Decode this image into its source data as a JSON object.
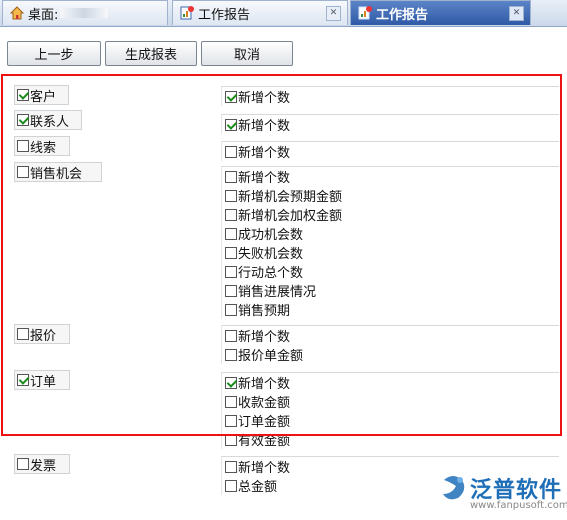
{
  "tabs": [
    {
      "label": "桌面:",
      "icon": "home-icon"
    },
    {
      "label": "工作报告",
      "icon": "report-icon"
    },
    {
      "label": "工作报告",
      "icon": "report-icon"
    }
  ],
  "toolbar": {
    "prev_label": "上一步",
    "generate_label": "生成报表",
    "cancel_label": "取消"
  },
  "groups": [
    {
      "label": "客户",
      "checked": true,
      "options": [
        {
          "label": "新增个数",
          "checked": true
        }
      ]
    },
    {
      "label": "联系人",
      "checked": true,
      "options": [
        {
          "label": "新增个数",
          "checked": true
        }
      ]
    },
    {
      "label": "线索",
      "checked": false,
      "options": [
        {
          "label": "新增个数",
          "checked": false
        }
      ]
    },
    {
      "label": "销售机会",
      "checked": false,
      "options": [
        {
          "label": "新增个数",
          "checked": false
        },
        {
          "label": "新增机会预期金额",
          "checked": false
        },
        {
          "label": "新增机会加权金额",
          "checked": false
        },
        {
          "label": "成功机会数",
          "checked": false
        },
        {
          "label": "失败机会数",
          "checked": false
        },
        {
          "label": "行动总个数",
          "checked": false
        },
        {
          "label": "销售进展情况",
          "checked": false
        },
        {
          "label": "销售预期",
          "checked": false
        }
      ]
    },
    {
      "label": "报价",
      "checked": false,
      "options": [
        {
          "label": "新增个数",
          "checked": false
        },
        {
          "label": "报价单金额",
          "checked": false
        }
      ]
    },
    {
      "label": "订单",
      "checked": true,
      "options": [
        {
          "label": "新增个数",
          "checked": true
        },
        {
          "label": "收款金额",
          "checked": false
        },
        {
          "label": "订单金额",
          "checked": false
        },
        {
          "label": "有效金额",
          "checked": false
        }
      ]
    },
    {
      "label": "发票",
      "checked": false,
      "options": [
        {
          "label": "新增个数",
          "checked": false
        },
        {
          "label": "总金额",
          "checked": false
        }
      ]
    }
  ],
  "watermark": {
    "name": "泛普软件",
    "url": "www.fanpusoft.com"
  },
  "colors": {
    "highlight_border": "#ee1111",
    "tab_active": "#2f5aa6",
    "check": "#1a8a1a"
  }
}
